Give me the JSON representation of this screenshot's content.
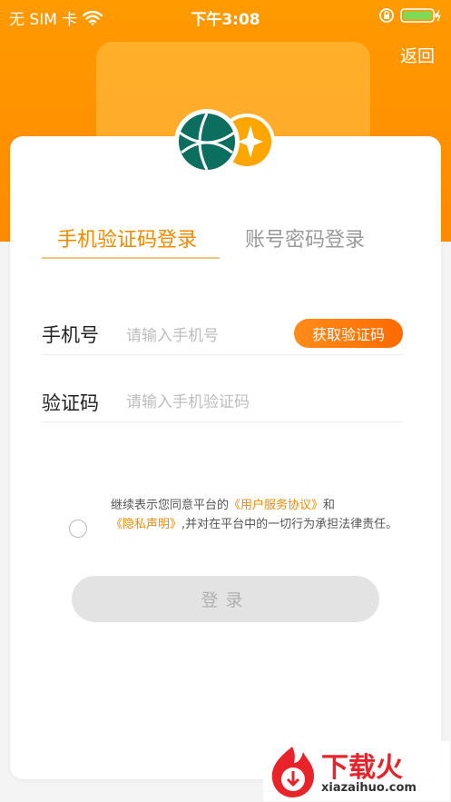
{
  "status_bar": {
    "carrier": "无 SIM 卡",
    "time": "下午3:08"
  },
  "header": {
    "back_label": "返回"
  },
  "tabs": [
    {
      "label": "手机验证码登录",
      "active": true
    },
    {
      "label": "账号密码登录",
      "active": false
    }
  ],
  "form": {
    "phone_label": "手机号",
    "phone_placeholder": "请输入手机号",
    "get_code_label": "获取验证码",
    "code_label": "验证码",
    "code_placeholder": "请输入手机验证码"
  },
  "agreement": {
    "prefix": "继续表示您同意平台的",
    "user_agreement": "《用户服务协议》",
    "and": "和",
    "privacy": "《隐私声明》",
    "suffix": ",并对在平台中的一切行为承担法律责任。"
  },
  "login_label": "登录",
  "watermark": {
    "brand": "下载火",
    "domain": "xiazaihuo.com"
  },
  "colors": {
    "accent": "#ff8a00",
    "tab_active": "#f28a00",
    "logo_green": "#0b6e5f",
    "logo_orange": "#ffa500"
  }
}
